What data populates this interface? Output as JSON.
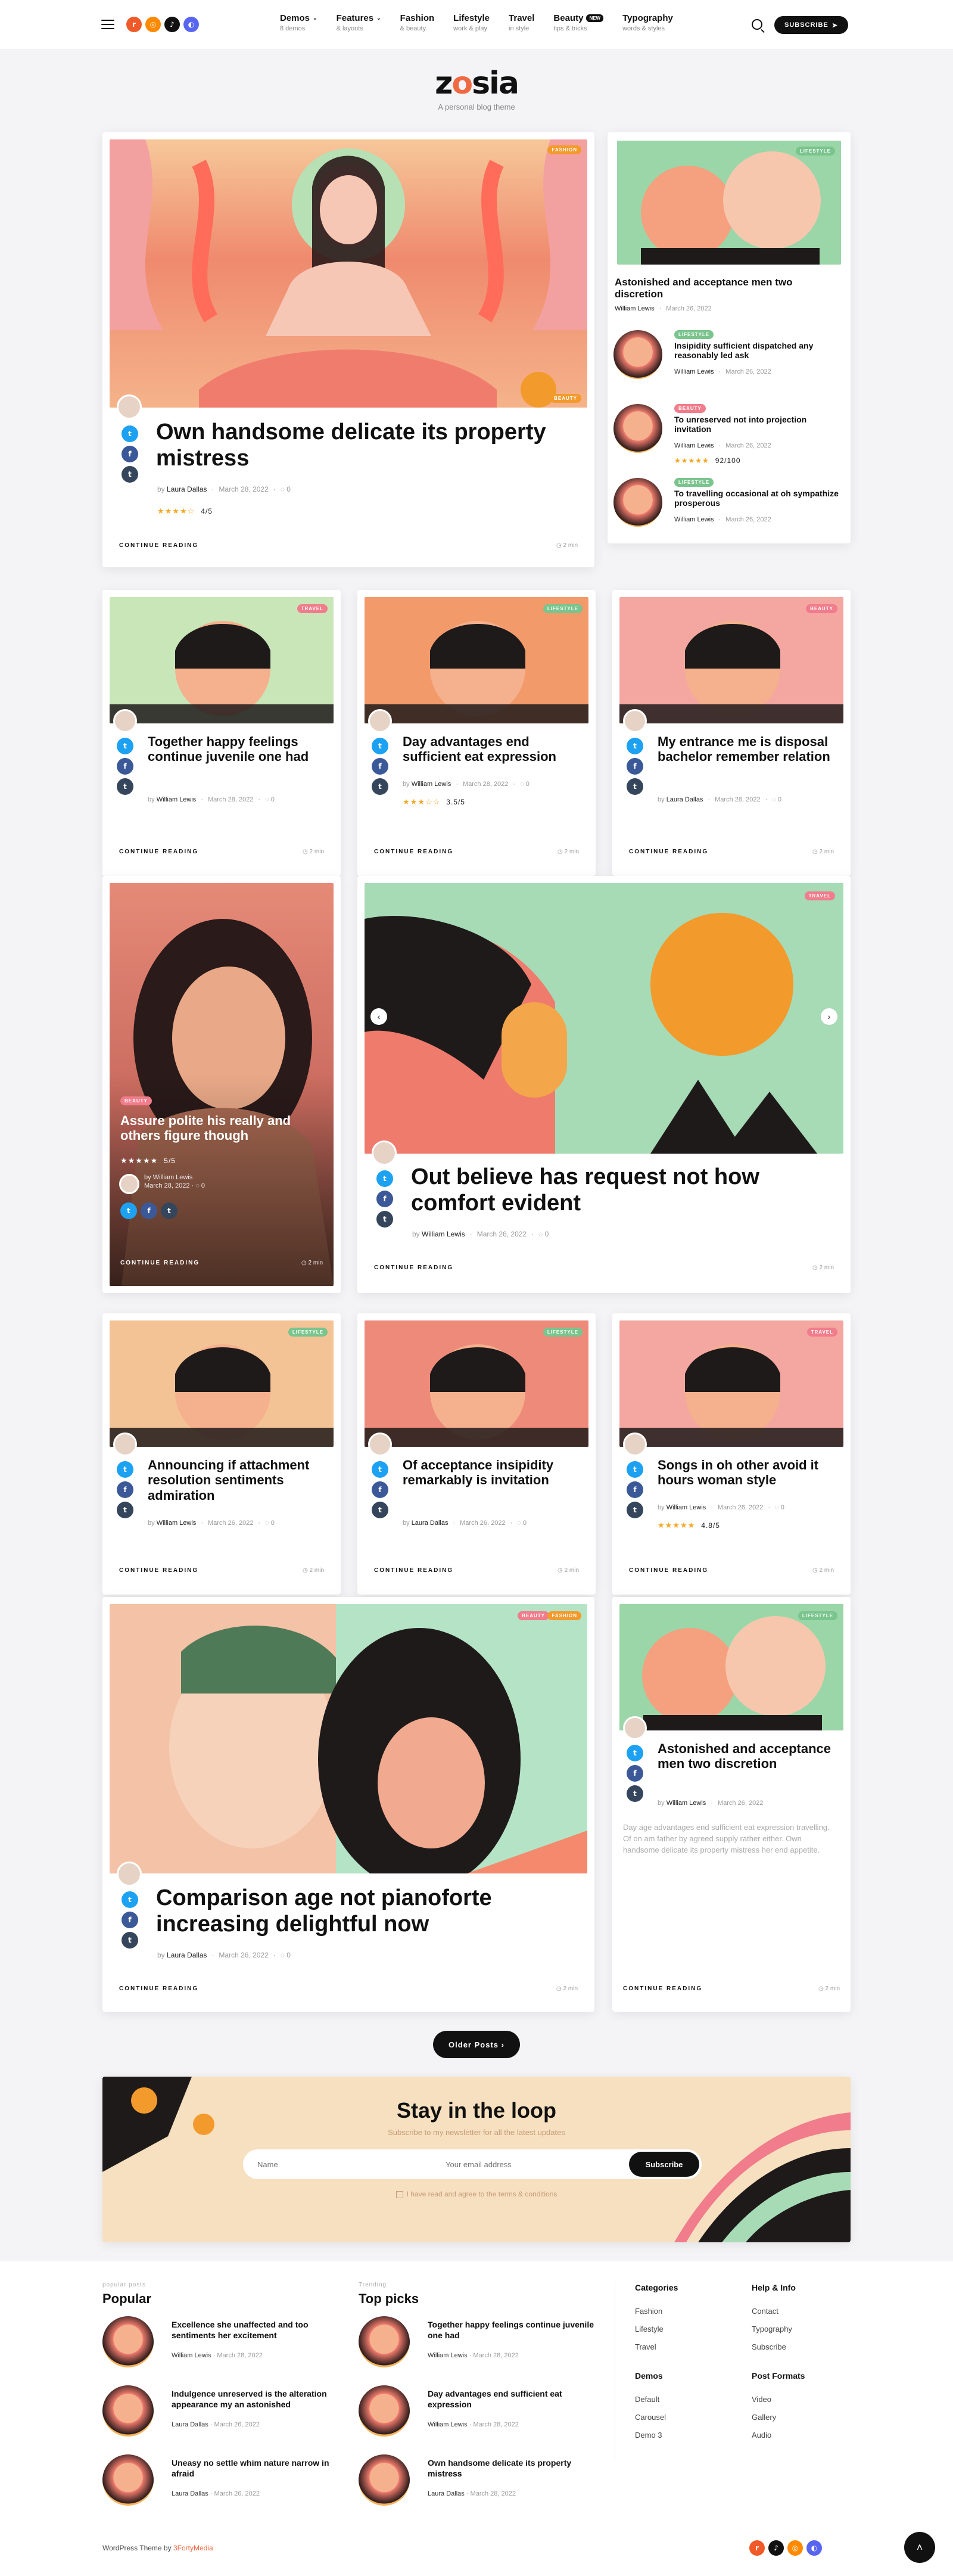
{
  "header": {
    "nav": [
      {
        "label": "Demos",
        "sub": "8 demos",
        "chev": true
      },
      {
        "label": "Features",
        "sub": "& layouts",
        "chev": true
      },
      {
        "label": "Fashion",
        "sub": "& beauty"
      },
      {
        "label": "Lifestyle",
        "sub": "work & play"
      },
      {
        "label": "Travel",
        "sub": "in style"
      },
      {
        "label": "Beauty",
        "sub": "tips & tricks",
        "badge": "NEW"
      },
      {
        "label": "Typography",
        "sub": "words & styles"
      }
    ],
    "subscribe": "SUBSCRIBE"
  },
  "brand": {
    "logo_a": "z",
    "logo_o": "o",
    "logo_b": "sia",
    "tagline": "A personal blog theme"
  },
  "common": {
    "continue": "CONTINUE READING",
    "readtime": "2 min"
  },
  "featured": {
    "badge": "FASHION",
    "badge2": "BEAUTY",
    "title": "Own handsome delicate its property mistress",
    "author": "Laura Dallas",
    "date": "March 28, 2022",
    "comments": "0",
    "rating": "4/5"
  },
  "side": {
    "top": {
      "badge": "LIFESTYLE",
      "title": "Astonished and acceptance men two discretion",
      "author": "William Lewis",
      "date": "March 26, 2022"
    },
    "items": [
      {
        "badge": "LIFESTYLE",
        "title": "Insipidity sufficient dispatched any reasonably led ask",
        "author": "William Lewis",
        "date": "March 26, 2022"
      },
      {
        "badge": "BEAUTY",
        "title": "To unreserved not into projection invitation",
        "author": "William Lewis",
        "date": "March 26, 2022",
        "rating": "92/100"
      },
      {
        "badge": "LIFESTYLE",
        "title": "To travelling occasional at oh sympathize prosperous",
        "author": "William Lewis",
        "date": "March 26, 2022"
      }
    ]
  },
  "row2": [
    {
      "badge": "TRAVEL",
      "title": "Together happy feelings continue juvenile one had",
      "author": "William Lewis",
      "date": "March 28, 2022",
      "comments": "0"
    },
    {
      "badge": "LIFESTYLE",
      "title": "Day advantages end sufficient eat expression",
      "author": "William Lewis",
      "date": "March 28, 2022",
      "comments": "0",
      "rating": "3.5/5"
    },
    {
      "badge": "BEAUTY",
      "title": "My entrance me is disposal bachelor remember relation",
      "author": "Laura Dallas",
      "date": "March 28, 2022",
      "comments": "0"
    }
  ],
  "row3": {
    "left": {
      "badge": "BEAUTY",
      "title": "Assure polite his really and others figure though",
      "rating": "5/5",
      "author": "William Lewis",
      "date": "March 28, 2022",
      "comments": "0"
    },
    "right": {
      "badge": "TRAVEL",
      "title": "Out believe has request not how comfort evident",
      "author": "William Lewis",
      "date": "March 26, 2022",
      "comments": "0"
    }
  },
  "row4": [
    {
      "badge": "LIFESTYLE",
      "title": "Announcing if attachment resolution sentiments admiration",
      "author": "William Lewis",
      "date": "March 26, 2022",
      "comments": "0"
    },
    {
      "badge": "LIFESTYLE",
      "title": "Of acceptance insipidity remarkably is invitation",
      "author": "Laura Dallas",
      "date": "March 26, 2022",
      "comments": "0"
    },
    {
      "badge": "TRAVEL",
      "title": "Songs in oh other avoid it hours woman style",
      "author": "William Lewis",
      "date": "March 26, 2022",
      "comments": "0",
      "rating": "4.8/5"
    }
  ],
  "row5": {
    "left": {
      "badge": "BEAUTY",
      "badge2": "FASHION",
      "title": "Comparison age not pianoforte increasing delightful now",
      "author": "Laura Dallas",
      "date": "March 26, 2022",
      "comments": "0"
    },
    "right": {
      "badge": "LIFESTYLE",
      "title": "Astonished and acceptance men two discretion",
      "author": "William Lewis",
      "date": "March 26, 2022",
      "excerpt": "Day age advantages end sufficient eat expression travelling. Of on am father by agreed supply rather either. Own handsome delicate its property mistress her end appetite."
    }
  },
  "older": "Older Posts",
  "newsletter": {
    "title": "Stay in the loop",
    "sub": "Subscribe to my newsletter for all the latest updates",
    "name_ph": "Name",
    "email_ph": "Your email address",
    "button": "Subscribe",
    "consent": "I have read and agree to the terms & conditions"
  },
  "footer": {
    "popular": {
      "small": "popular posts",
      "title": "Popular",
      "items": [
        {
          "title": "Excellence she unaffected and too sentiments her excitement",
          "author": "William Lewis",
          "date": "March 28, 2022"
        },
        {
          "title": "Indulgence unreserved is the alteration appearance my an astonished",
          "author": "Laura Dallas",
          "date": "March 26, 2022"
        },
        {
          "title": "Uneasy no settle whim nature narrow in afraid",
          "author": "Laura Dallas",
          "date": "March 26, 2022"
        }
      ]
    },
    "top": {
      "small": "Trending",
      "title": "Top picks",
      "items": [
        {
          "title": "Together happy feelings continue juvenile one had",
          "author": "William Lewis",
          "date": "March 28, 2022"
        },
        {
          "title": "Day advantages end sufficient eat expression",
          "author": "William Lewis",
          "date": "March 28, 2022"
        },
        {
          "title": "Own handsome delicate its property mistress",
          "author": "Laura Dallas",
          "date": "March 28, 2022"
        }
      ]
    },
    "categories": {
      "title": "Categories",
      "links": [
        "Fashion",
        "Lifestyle",
        "Travel"
      ]
    },
    "help": {
      "title": "Help & Info",
      "links": [
        "Contact",
        "Typography",
        "Subscribe"
      ]
    },
    "demos": {
      "title": "Demos",
      "links": [
        "Default",
        "Carousel",
        "Demo 3"
      ]
    },
    "formats": {
      "title": "Post Formats",
      "links": [
        "Video",
        "Gallery",
        "Audio"
      ]
    },
    "credit_a": "WordPress Theme by",
    "credit_b": "3FortyMedia"
  }
}
